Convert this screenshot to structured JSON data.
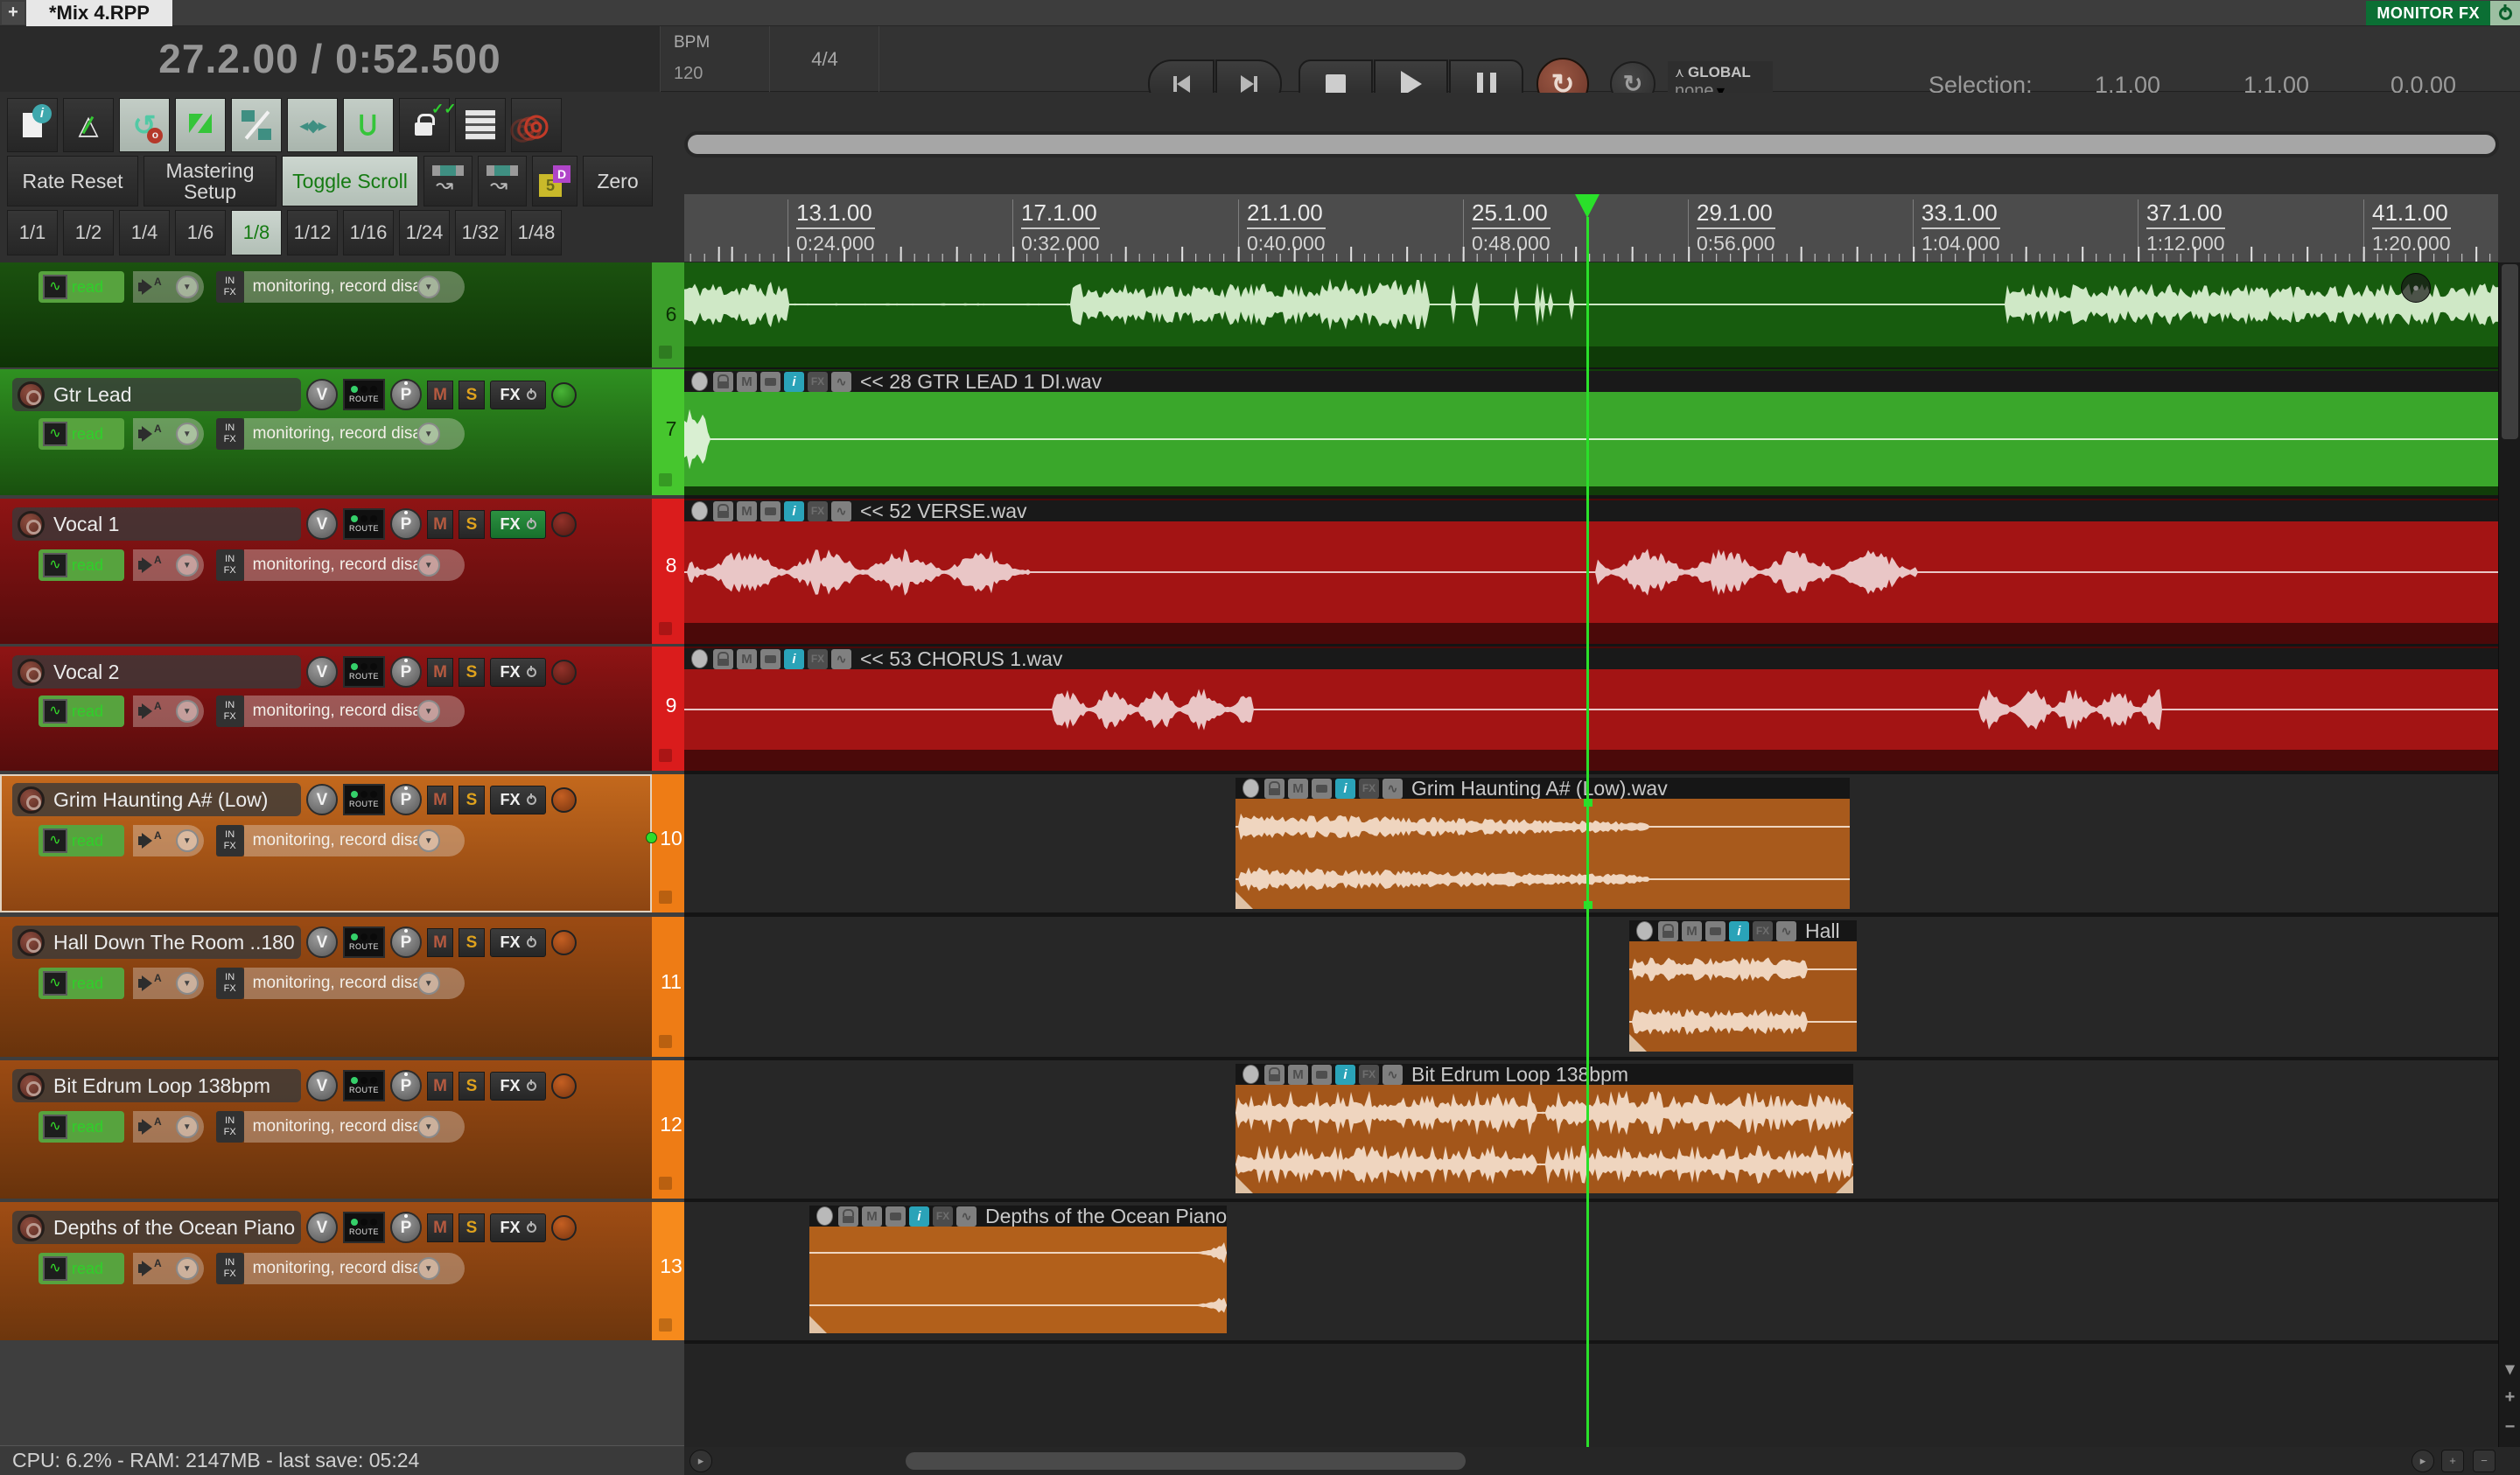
{
  "tab_bar": {
    "new_tab": "+",
    "active_tab": "*Mix 4.RPP",
    "monitor_fx": "MONITOR FX"
  },
  "transport": {
    "time_display": "27.2.00 / 0:52.500",
    "bpm_label": "BPM",
    "bpm_value": "120",
    "time_signature": "4/4",
    "global_label": "GLOBAL",
    "global_value": "none",
    "selection_label": "Selection:",
    "selection_start": "1.1.00",
    "selection_end": "1.1.00",
    "selection_length": "0.0.00"
  },
  "toolbar": {
    "rate_reset": "Rate Reset",
    "mastering_setup": "Mastering Setup",
    "toggle_scroll": "Toggle Scroll",
    "zero": "Zero",
    "five": "5",
    "d": "D",
    "grid_divisions": [
      "1/1",
      "1/2",
      "1/4",
      "1/6",
      "1/8",
      "1/12",
      "1/16",
      "1/24",
      "1/32",
      "1/48"
    ],
    "active_division": "1/8"
  },
  "tcp": {
    "controls": {
      "volume": "V",
      "route": "ROUTE",
      "pan": "P",
      "mute": "M",
      "solo": "S",
      "fx": "FX",
      "env_mode": "read",
      "input_auto": "A",
      "input_fx_line1": "IN",
      "input_fx_line2": "FX",
      "monitoring_text": "monitoring, record disa"
    },
    "tracks": [
      {
        "number": "6",
        "name": ""
      },
      {
        "number": "7",
        "name": "Gtr Lead"
      },
      {
        "number": "8",
        "name": "Vocal 1"
      },
      {
        "number": "9",
        "name": "Vocal 2"
      },
      {
        "number": "10",
        "name": "Grim Haunting A# (Low)"
      },
      {
        "number": "11",
        "name": "Hall Down The Room ..180"
      },
      {
        "number": "12",
        "name": "Bit Edrum Loop 138bpm"
      },
      {
        "number": "13",
        "name": "Depths of the Ocean Piano"
      }
    ]
  },
  "ruler": {
    "marks": [
      {
        "bar": "13.1.00",
        "time": "0:24.000"
      },
      {
        "bar": "17.1.00",
        "time": "0:32.000"
      },
      {
        "bar": "21.1.00",
        "time": "0:40.000"
      },
      {
        "bar": "25.1.00",
        "time": "0:48.000"
      },
      {
        "bar": "29.1.00",
        "time": "0:56.000"
      },
      {
        "bar": "33.1.00",
        "time": "1:04.000"
      },
      {
        "bar": "37.1.00",
        "time": "1:12.000"
      },
      {
        "bar": "41.1.00",
        "time": "1:20.000"
      }
    ]
  },
  "arrange": {
    "icon_mute": "M",
    "icon_info": "i",
    "icon_fx": "FX",
    "icon_env": "∿",
    "items": {
      "gtr_lead": "<< 28 GTR LEAD 1 DI.wav",
      "verse": "<< 52 VERSE.wav",
      "chorus": "<< 53 CHORUS 1.wav",
      "grim": "Grim Haunting A# (Low).wav",
      "hall": "Hall",
      "edrum": "Bit Edrum Loop 138bpm",
      "piano": "Depths of the Ocean Piano"
    }
  },
  "status_bar": {
    "text": "CPU: 6.2% - RAM: 2147MB -  last save: 05:24"
  }
}
